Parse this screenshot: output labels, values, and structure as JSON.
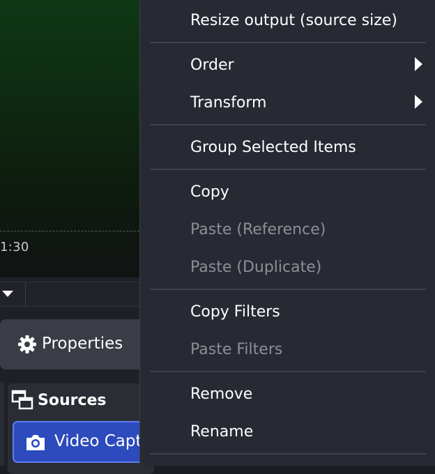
{
  "preview": {
    "timestamp": "1:30"
  },
  "properties_button": {
    "label": "Properties",
    "icon": "gear-icon"
  },
  "sources": {
    "title": "Sources",
    "icon": "sources-icon",
    "items": [
      {
        "label": "Video Capt",
        "icon": "camera-icon"
      }
    ]
  },
  "context_menu": {
    "items": [
      {
        "label": "Resize output (source size)",
        "enabled": true
      },
      {
        "label": "Order",
        "enabled": true,
        "submenu": true
      },
      {
        "label": "Transform",
        "enabled": true,
        "submenu": true
      },
      {
        "label": "Group Selected Items",
        "enabled": true
      },
      {
        "label": "Copy",
        "enabled": true
      },
      {
        "label": "Paste (Reference)",
        "enabled": false
      },
      {
        "label": "Paste (Duplicate)",
        "enabled": false
      },
      {
        "label": "Copy Filters",
        "enabled": true
      },
      {
        "label": "Paste Filters",
        "enabled": false
      },
      {
        "label": "Remove",
        "enabled": true
      },
      {
        "label": "Rename",
        "enabled": true
      }
    ]
  },
  "colors": {
    "menu_bg": "#272a33",
    "disabled_text": "#8d8f96",
    "selected_source": "#2d4bbd"
  }
}
